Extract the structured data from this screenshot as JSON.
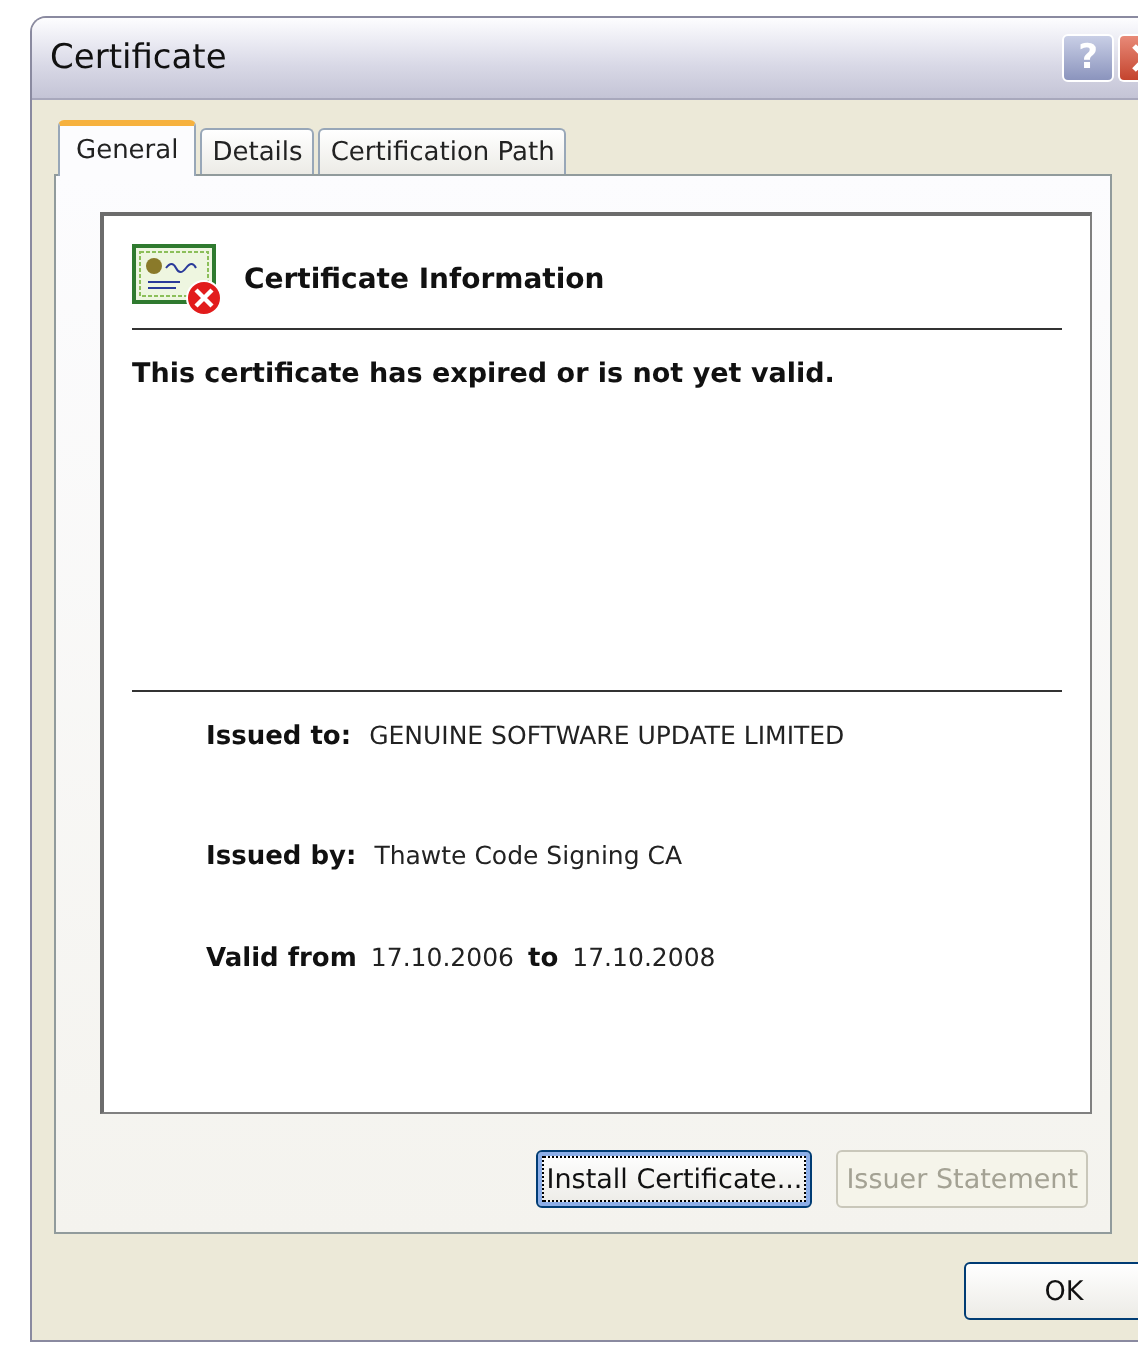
{
  "window": {
    "title": "Certificate",
    "help_button": "?"
  },
  "tabs": [
    {
      "label": "General",
      "selected": true
    },
    {
      "label": "Details",
      "selected": false
    },
    {
      "label": "Certification Path",
      "selected": false
    }
  ],
  "info": {
    "heading": "Certificate Information",
    "message": "This certificate has expired or is not yet valid."
  },
  "fields": [
    {
      "label": "Issued to:",
      "value": "GENUINE SOFTWARE UPDATE LIMITED"
    },
    {
      "label": "Issued by:",
      "value": "Thawte Code Signing CA"
    }
  ],
  "validity": {
    "label": "Valid from",
    "from": "17.10.2006",
    "separator": "to",
    "to": "17.10.2008"
  },
  "panel_buttons": [
    {
      "label": "Install Certificate...",
      "disabled": false,
      "focused": true
    },
    {
      "label": "Issuer Statement",
      "disabled": true,
      "focused": false
    }
  ],
  "ok_button": "OK"
}
